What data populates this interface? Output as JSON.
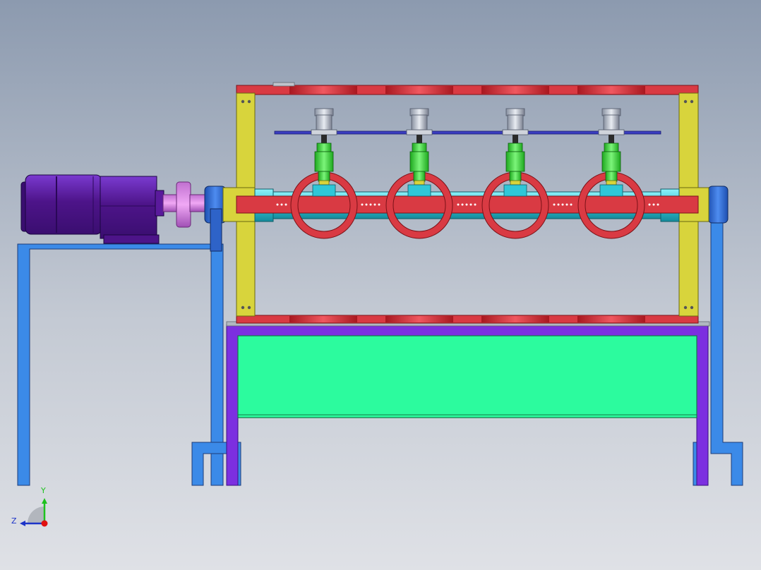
{
  "viewport": {
    "background_top": "#8c9aaf",
    "background_bottom": "#dfe1e6"
  },
  "colors": {
    "motor": "#5a1a9c",
    "coupling": "#d580e0",
    "bearing_block": "#2e63c8",
    "support_legs": "#3b8ae8",
    "frame_posts": "#d8d43c",
    "frame_rails": "#d93a43",
    "shaft": "#2fc7d8",
    "crank_rings": "#d93a43",
    "actuators": "#37e036",
    "carriage_bar": "#3a3dc0",
    "base_frame": "#7c2fe0",
    "tank": "#2cfb9e"
  },
  "triad": {
    "y_label": "Y",
    "z_label": "Z",
    "y_color": "#1ec21e",
    "z_color": "#1d34c8",
    "origin_color": "#e01010"
  }
}
